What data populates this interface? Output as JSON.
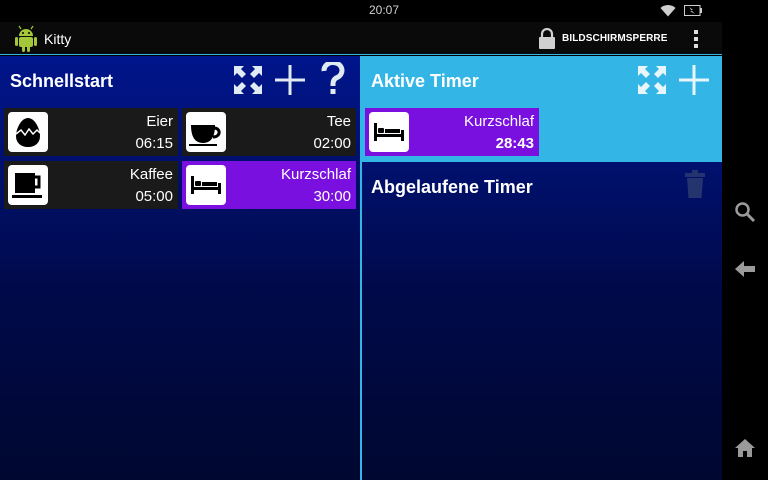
{
  "status": {
    "time": "20:07"
  },
  "app": {
    "title": "Kitty",
    "lock_label": "BILDSCHIRMSPERRE"
  },
  "quickstart": {
    "title": "Schnellstart",
    "items": [
      {
        "name": "Eier",
        "time": "06:15",
        "icon": "egg-icon",
        "highlight": false
      },
      {
        "name": "Tee",
        "time": "02:00",
        "icon": "teacup-icon",
        "highlight": false
      },
      {
        "name": "Kaffee",
        "time": "05:00",
        "icon": "coffee-cup-icon",
        "highlight": false
      },
      {
        "name": "Kurzschlaf",
        "time": "30:00",
        "icon": "bed-icon",
        "highlight": true
      }
    ]
  },
  "active": {
    "title": "Aktive Timer",
    "items": [
      {
        "name": "Kurzschlaf",
        "time": "28:43",
        "icon": "bed-icon"
      }
    ]
  },
  "expired": {
    "title": "Abgelaufene Timer"
  },
  "colors": {
    "accent": "#33b5e5",
    "highlight_tile": "#7a10e0",
    "tile_bg": "#1a1a1a",
    "panel_top": "#00158c",
    "panel_bottom": "#000730"
  }
}
